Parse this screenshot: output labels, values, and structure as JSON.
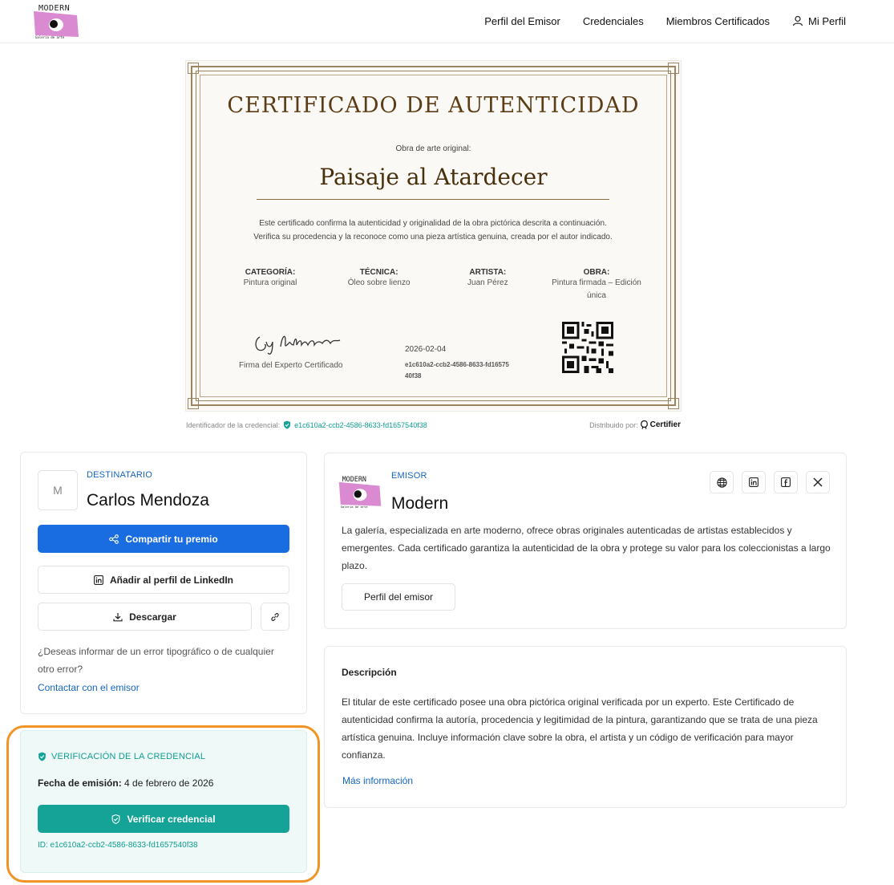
{
  "header": {
    "logo_text": "MODERN",
    "logo_caption": "Galería de arte",
    "nav": [
      "Perfil del Emisor",
      "Credenciales",
      "Miembros Certificados",
      "Mi Perfil"
    ]
  },
  "certificate": {
    "title": "CERTIFICADO DE AUTENTICIDAD",
    "subtitle": "Obra de arte original:",
    "artwork": "Paisaje al Atardecer",
    "description": "Este certificado confirma la autenticidad y originalidad de la obra pictórica descrita a continuación. Verifica su procedencia y la reconoce como una pieza artística genuina, creada por el autor indicado.",
    "fields": [
      {
        "key": "CATEGORÍA:",
        "value": "Pintura original"
      },
      {
        "key": "TÉCNICA:",
        "value": "Óleo sobre lienzo"
      },
      {
        "key": "ARTISTA:",
        "value": "Juan Pérez"
      },
      {
        "key": "OBRA:",
        "value": "Pintura firmada – Edición única"
      }
    ],
    "signature_label": "Firma del Experto Certificado",
    "date": "2026-02-04",
    "id": "e1c610a2-ccb2-4586-8633-fd1657540f38"
  },
  "meta": {
    "id_label": "Identificador de la credencial:",
    "id": "e1c610a2-ccb2-4586-8633-fd1657540f38",
    "distributed_label": "Distribuido por:",
    "distributor": "Certifier"
  },
  "recipient": {
    "label": "DESTINATARIO",
    "initial": "M",
    "name": "Carlos Mendoza",
    "share_button": "Compartir tu premio",
    "linkedin_button": "Añadir al perfil de LinkedIn",
    "download_button": "Descargar",
    "report_question": "¿Deseas informar de un error tipográfico o de cualquier otro error?",
    "contact_link": "Contactar con el emisor"
  },
  "issuer": {
    "label": "EMISOR",
    "logo_text": "MODERN",
    "logo_caption": "Galería de arte",
    "name": "Modern",
    "description": "La galería, especializada en arte moderno, ofrece obras originales autenticadas de artistas establecidos y emergentes. Cada certificado garantiza la autenticidad de la obra y protege su valor para los coleccionistas a largo plazo.",
    "profile_button": "Perfil del emisor",
    "socials": [
      "globe-icon",
      "linkedin-icon",
      "facebook-icon",
      "x-icon"
    ]
  },
  "description": {
    "title": "Descripción",
    "text": "El titular de este certificado posee una obra pictórica original verificada por un experto. Este Certificado de autenticidad confirma la autoría, procedencia y legitimidad de la pintura, garantizando que se trata de una pieza artística genuina. Incluye información clave sobre la obra, el artista y un código de verificación para mayor confianza.",
    "more_link": "Más información"
  },
  "verification": {
    "title": "VERIFICACIÓN DE LA CREDENCIAL",
    "date_label": "Fecha de emisión:",
    "date_value": "4 de febrero de 2026",
    "verify_button": "Verificar credencial",
    "id_text": "ID: e1c610a2-ccb2-4586-8633-fd1657540f38"
  },
  "colors": {
    "primary_blue": "#1a6de0",
    "teal": "#14a396",
    "highlight_orange": "#f09426",
    "certificate_brown": "#5c3d15",
    "logo_pink": "#d98ad1"
  }
}
